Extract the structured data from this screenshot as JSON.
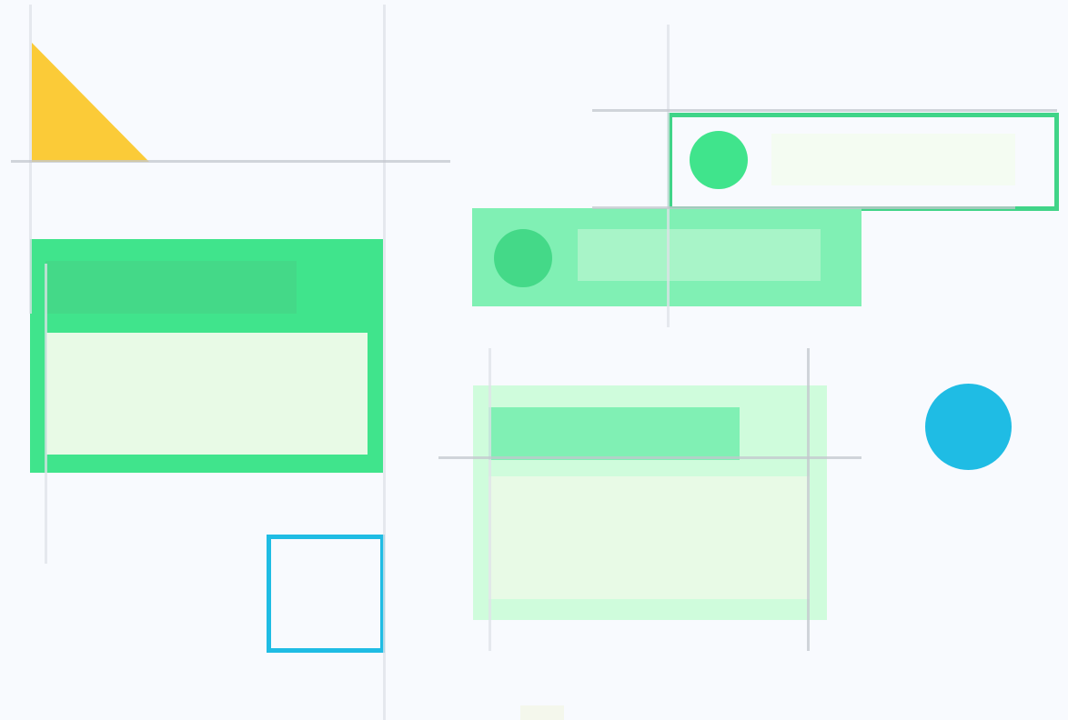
{
  "canvas": {
    "background": "#f8fafe"
  },
  "palette": {
    "green_strong": "#40e48c",
    "green_medium": "#80f0b4",
    "green_pale": "#cffcdc",
    "mint_fill": "#e8fae6",
    "mint_light": "#f4fcf2",
    "yellow": "#fbcb38",
    "blue": "#1fbce4",
    "guide": "#dcdfe5"
  },
  "shapes": [
    {
      "name": "yellow-triangle",
      "kind": "triangle",
      "color": "#fbcb38"
    },
    {
      "name": "green-card",
      "kind": "card",
      "color": "#40e48c"
    },
    {
      "name": "outlined-list-item",
      "kind": "list-item",
      "color": "#40e48c"
    },
    {
      "name": "filled-list-item",
      "kind": "list-item",
      "color": "#80f0b4"
    },
    {
      "name": "pale-green-card",
      "kind": "card",
      "color": "#cffcdc"
    },
    {
      "name": "blue-circle",
      "kind": "circle",
      "color": "#1fbce4"
    },
    {
      "name": "blue-outlined-square",
      "kind": "square",
      "color": "#1fbce4"
    }
  ]
}
